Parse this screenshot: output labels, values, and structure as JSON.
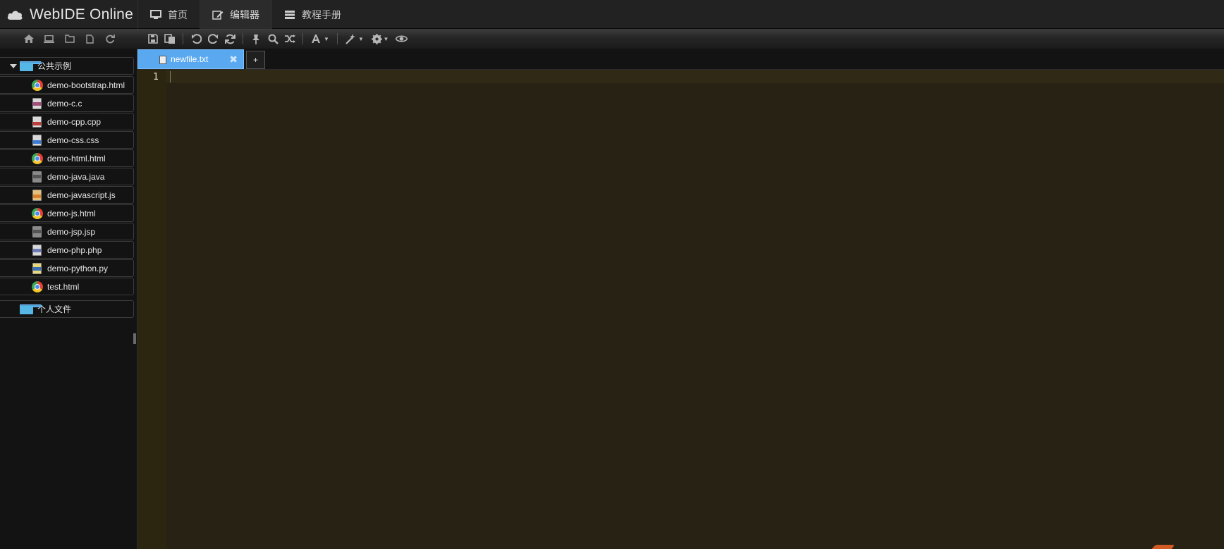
{
  "navbar": {
    "brand": "WebIDE Online",
    "items": [
      {
        "label": "首页",
        "icon": "monitor-icon"
      },
      {
        "label": "编辑器",
        "icon": "edit-icon"
      },
      {
        "label": "教程手册",
        "icon": "list-icon"
      }
    ],
    "active_index": 1
  },
  "toolbar": {
    "left_icons": [
      "home-icon",
      "laptop-icon",
      "new-folder-icon",
      "new-file-icon",
      "refresh-icon"
    ],
    "right_icons": [
      "save-icon",
      "save-all-icon",
      "undo-icon",
      "redo-icon",
      "reload-icon",
      "pin-icon",
      "search-icon",
      "shuffle-icon",
      "font-icon",
      "magic-wand-icon",
      "gear-icon",
      "eye-icon"
    ]
  },
  "sidebar": {
    "folders": [
      {
        "label": "公共示例",
        "expanded": true,
        "files": [
          {
            "label": "demo-bootstrap.html",
            "icon": "chrome-icon"
          },
          {
            "label": "demo-c.c",
            "icon": "c-file-icon"
          },
          {
            "label": "demo-cpp.cpp",
            "icon": "cpp-file-icon"
          },
          {
            "label": "demo-css.css",
            "icon": "css-file-icon"
          },
          {
            "label": "demo-html.html",
            "icon": "chrome-icon"
          },
          {
            "label": "demo-java.java",
            "icon": "java-file-icon"
          },
          {
            "label": "demo-javascript.js",
            "icon": "js-file-icon"
          },
          {
            "label": "demo-js.html",
            "icon": "chrome-icon"
          },
          {
            "label": "demo-jsp.jsp",
            "icon": "jsp-file-icon"
          },
          {
            "label": "demo-php.php",
            "icon": "php-file-icon"
          },
          {
            "label": "demo-python.py",
            "icon": "python-file-icon"
          },
          {
            "label": "test.html",
            "icon": "chrome-icon"
          }
        ]
      },
      {
        "label": "个人文件",
        "expanded": false
      }
    ]
  },
  "tabs": {
    "open": [
      {
        "label": "newfile.txt",
        "close": "✖"
      }
    ],
    "add_label": "+"
  },
  "editor": {
    "line_numbers": [
      "1"
    ],
    "content": ""
  },
  "colors": {
    "tab_active": "#5aa9f0",
    "editor_bg": "#272214",
    "gutter_bg": "#2c2610",
    "folder": "#56b6e6"
  }
}
